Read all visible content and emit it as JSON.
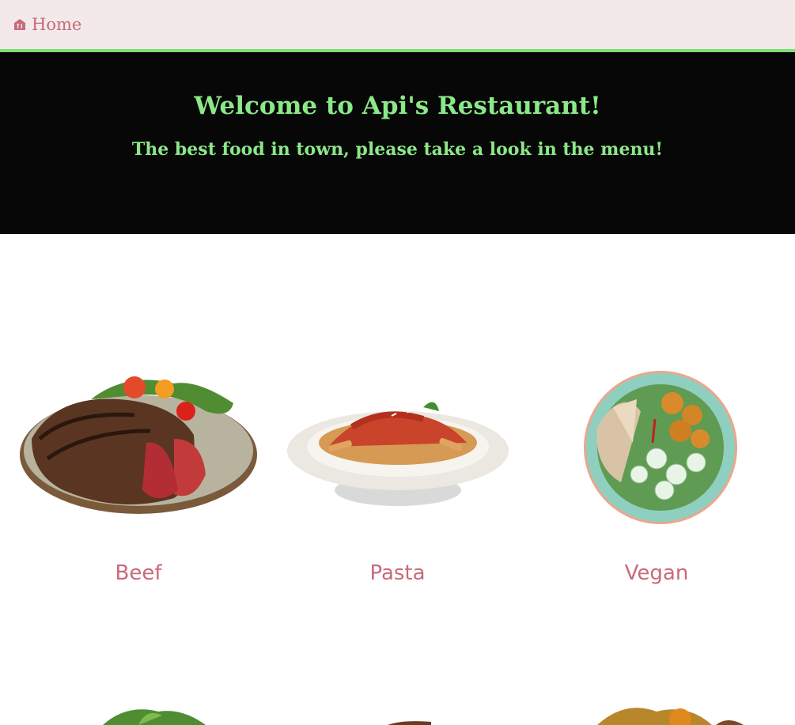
{
  "nav": {
    "home_label": "Home",
    "home_icon": "restaurant-icon"
  },
  "hero": {
    "title": "Welcome to Api's Restaurant!",
    "subtitle": "The best food in town, please take a look in the menu!"
  },
  "menu": {
    "items": [
      {
        "label": "Beef",
        "image": "steak-plate-image"
      },
      {
        "label": "Pasta",
        "image": "penne-pasta-image"
      },
      {
        "label": "Vegan",
        "image": "vegan-bowl-image"
      }
    ]
  },
  "colors": {
    "nav_bg": "#f3e9ea",
    "accent_pink": "#c86a7a",
    "accent_green": "#8ae888",
    "hero_bg": "#070707"
  }
}
